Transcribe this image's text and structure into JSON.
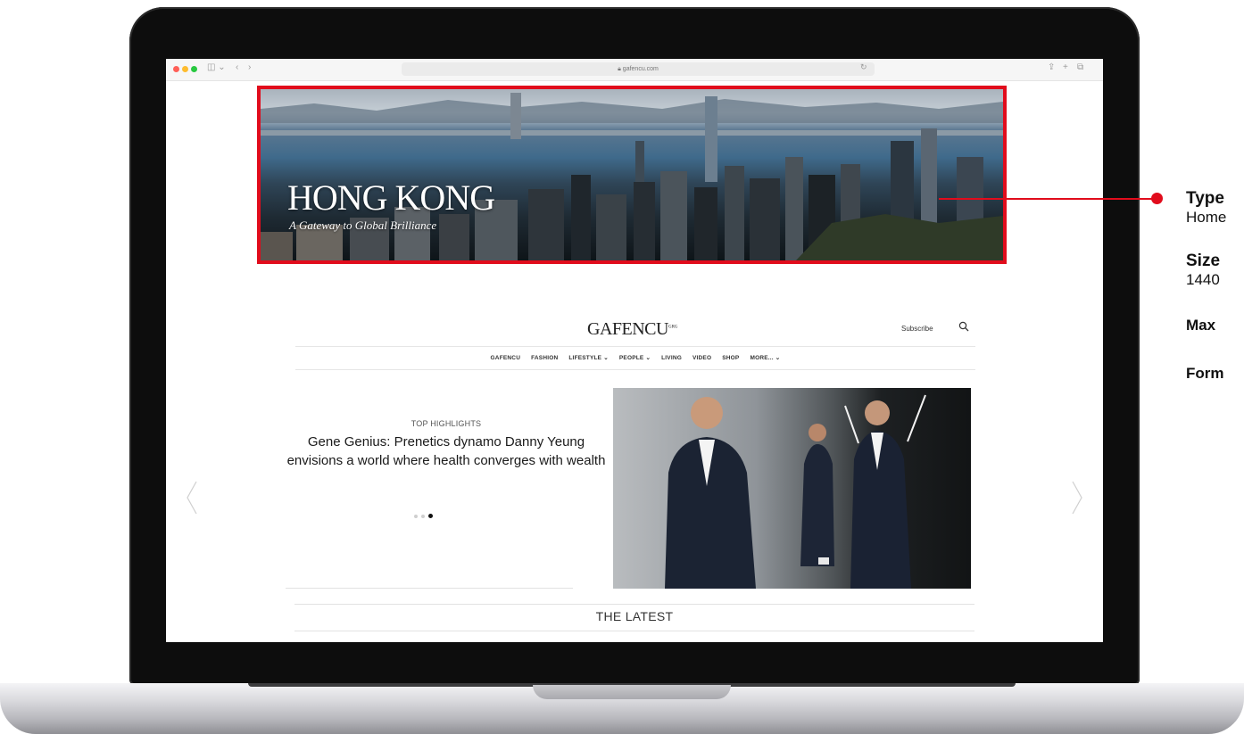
{
  "browser": {
    "url": "gafencu.com"
  },
  "banner": {
    "title": "HONG KONG",
    "subtitle": "A Gateway to Global Brilliance"
  },
  "site": {
    "logo": "GAFENCU",
    "logo_sup": "GRG",
    "subscribe_label": "Subscribe",
    "nav": [
      "GAFENCU",
      "FASHION",
      "LIFESTYLE ⌄",
      "PEOPLE ⌄",
      "LIVING",
      "VIDEO",
      "SHOP",
      "MORE... ⌄"
    ]
  },
  "hero": {
    "label": "TOP HIGHLIGHTS",
    "title": "Gene Genius: Prenetics dynamo Danny Yeung envisions a world where health converges with wealth",
    "pager_active": 3,
    "pager_total": 3
  },
  "section": {
    "latest": "THE LATEST"
  },
  "annotation": {
    "type_label": "Type",
    "type_value": "Home",
    "size_label": "Size",
    "size_value": "1440",
    "max_label": "Max",
    "format_label": "Form"
  },
  "colors": {
    "accent": "#e10c1c"
  }
}
